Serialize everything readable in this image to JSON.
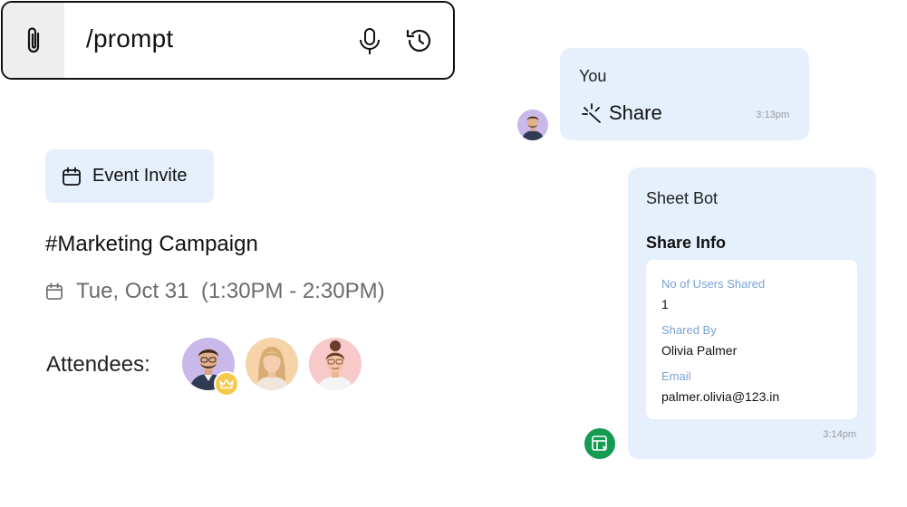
{
  "prompt_bar": {
    "text": "/prompt",
    "icons": [
      "paperclip-icon",
      "microphone-icon",
      "history-icon"
    ]
  },
  "event": {
    "chip_label": "Event Invite",
    "title": "#Marketing Campaign",
    "date": "Tue, Oct 31  (1:30PM - 2:30PM)",
    "attendees_label": "Attendees:",
    "attendees": [
      {
        "avatar": "man-glasses-avatar",
        "bg": "#c9b8ea",
        "badge": "crown-icon"
      },
      {
        "avatar": "woman-blonde-avatar",
        "bg": "#f6d3a8"
      },
      {
        "avatar": "woman-bun-avatar",
        "bg": "#f7c9c9"
      }
    ]
  },
  "chat": {
    "user_message": {
      "sender": "You",
      "action": "Share",
      "time": "3:13pm"
    },
    "bot_message": {
      "sender": "Sheet Bot",
      "heading": "Share Info",
      "fields": [
        {
          "label": "No of Users Shared",
          "value": "1"
        },
        {
          "label": "Shared By",
          "value": "Olivia Palmer"
        },
        {
          "label": "Email",
          "value": "palmer.olivia@123.in"
        }
      ],
      "time": "3:14pm"
    }
  },
  "colors": {
    "bubble_bg": "#e5f0fc",
    "field_label": "#7aa2d6",
    "bot_green": "#159a52",
    "crown": "#f7c94a"
  }
}
